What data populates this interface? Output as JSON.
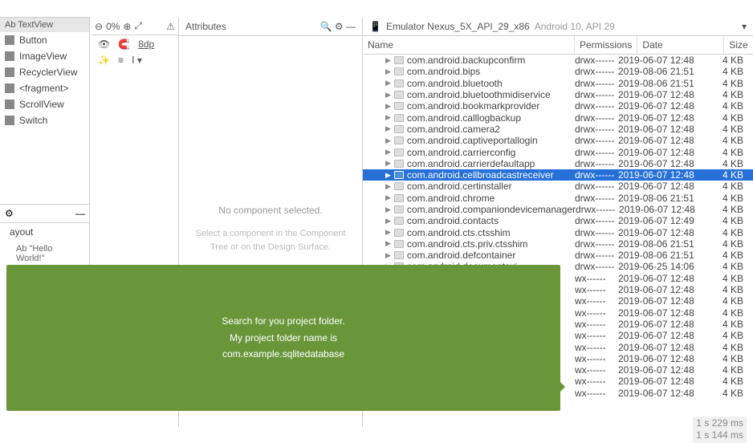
{
  "palette": {
    "header": "Ab TextView",
    "items": [
      "Button",
      "ImageView",
      "RecyclerView",
      "<fragment>",
      "ScrollView",
      "Switch"
    ]
  },
  "tree": {
    "root": "ayout",
    "child": "Ab \"Hello World!\""
  },
  "zoom": {
    "pct": "0%"
  },
  "design_tools": {
    "dp": "8dp"
  },
  "attributes": {
    "title": "Attributes",
    "msg": "No component selected.",
    "sub": "Select a component in the Component Tree or on the Design Surface."
  },
  "device": {
    "icon": "📱",
    "name": "Emulator Nexus_5X_API_29_x86",
    "api": "Android 10, API 29",
    "columns": [
      "Name",
      "Permissions",
      "Date",
      "Size"
    ],
    "rows": [
      {
        "n": "com.android.backupconfirm",
        "p": "drwx------",
        "d": "2019-06-07 12:48",
        "s": "4 KB"
      },
      {
        "n": "com.android.bips",
        "p": "drwx------",
        "d": "2019-08-06 21:51",
        "s": "4 KB"
      },
      {
        "n": "com.android.bluetooth",
        "p": "drwx------",
        "d": "2019-08-06 21:51",
        "s": "4 KB"
      },
      {
        "n": "com.android.bluetoothmidiservice",
        "p": "drwx------",
        "d": "2019-06-07 12:48",
        "s": "4 KB"
      },
      {
        "n": "com.android.bookmarkprovider",
        "p": "drwx------",
        "d": "2019-06-07 12:48",
        "s": "4 KB"
      },
      {
        "n": "com.android.calllogbackup",
        "p": "drwx------",
        "d": "2019-06-07 12:48",
        "s": "4 KB"
      },
      {
        "n": "com.android.camera2",
        "p": "drwx------",
        "d": "2019-06-07 12:48",
        "s": "4 KB"
      },
      {
        "n": "com.android.captiveportallogin",
        "p": "drwx------",
        "d": "2019-06-07 12:48",
        "s": "4 KB"
      },
      {
        "n": "com.android.carrierconfig",
        "p": "drwx------",
        "d": "2019-06-07 12:48",
        "s": "4 KB"
      },
      {
        "n": "com.android.carrierdefaultapp",
        "p": "drwx------",
        "d": "2019-06-07 12:48",
        "s": "4 KB"
      },
      {
        "n": "com.android.cellbroadcastreceiver",
        "p": "drwx------",
        "d": "2019-06-07 12:48",
        "s": "4 KB",
        "sel": true
      },
      {
        "n": "com.android.certinstaller",
        "p": "drwx------",
        "d": "2019-06-07 12:48",
        "s": "4 KB"
      },
      {
        "n": "com.android.chrome",
        "p": "drwx------",
        "d": "2019-08-06 21:51",
        "s": "4 KB"
      },
      {
        "n": "com.android.companiondevicemanager",
        "p": "drwx------",
        "d": "2019-06-07 12:48",
        "s": "4 KB"
      },
      {
        "n": "com.android.contacts",
        "p": "drwx------",
        "d": "2019-06-07 12:49",
        "s": "4 KB"
      },
      {
        "n": "com.android.cts.ctsshim",
        "p": "drwx------",
        "d": "2019-06-07 12:48",
        "s": "4 KB"
      },
      {
        "n": "com.android.cts.priv.ctsshim",
        "p": "drwx------",
        "d": "2019-08-06 21:51",
        "s": "4 KB"
      },
      {
        "n": "com.android.defcontainer",
        "p": "drwx------",
        "d": "2019-08-06 21:51",
        "s": "4 KB"
      },
      {
        "n": "com.android.documentsui",
        "p": "drwx------",
        "d": "2019-06-25 14:06",
        "s": "4 KB"
      },
      {
        "n": "",
        "p": "wx------",
        "d": "2019-06-07 12:48",
        "s": "4 KB"
      },
      {
        "n": "",
        "p": "wx------",
        "d": "2019-06-07 12:48",
        "s": "4 KB"
      },
      {
        "n": "",
        "p": "wx------",
        "d": "2019-06-07 12:48",
        "s": "4 KB"
      },
      {
        "n": "",
        "p": "wx------",
        "d": "2019-06-07 12:48",
        "s": "4 KB"
      },
      {
        "n": "",
        "p": "wx------",
        "d": "2019-06-07 12:48",
        "s": "4 KB"
      },
      {
        "n": "",
        "p": "wx------",
        "d": "2019-06-07 12:48",
        "s": "4 KB"
      },
      {
        "n": "",
        "p": "wx------",
        "d": "2019-06-07 12:48",
        "s": "4 KB"
      },
      {
        "n": "",
        "p": "wx------",
        "d": "2019-06-07 12:48",
        "s": "4 KB"
      },
      {
        "n": "",
        "p": "wx------",
        "d": "2019-06-07 12:48",
        "s": "4 KB"
      },
      {
        "n": "",
        "p": "wx------",
        "d": "2019-06-07 12:48",
        "s": "4 KB"
      },
      {
        "n": "",
        "p": "wx------",
        "d": "2019-06-07 12:48",
        "s": "4 KB"
      }
    ],
    "timing1": "1 s 229 ms",
    "timing2": "1 s 144 ms"
  },
  "callout": {
    "l1": "Search for you project folder.",
    "l2": "My project folder name is",
    "l3": "com.example.sqlitedatabase"
  }
}
